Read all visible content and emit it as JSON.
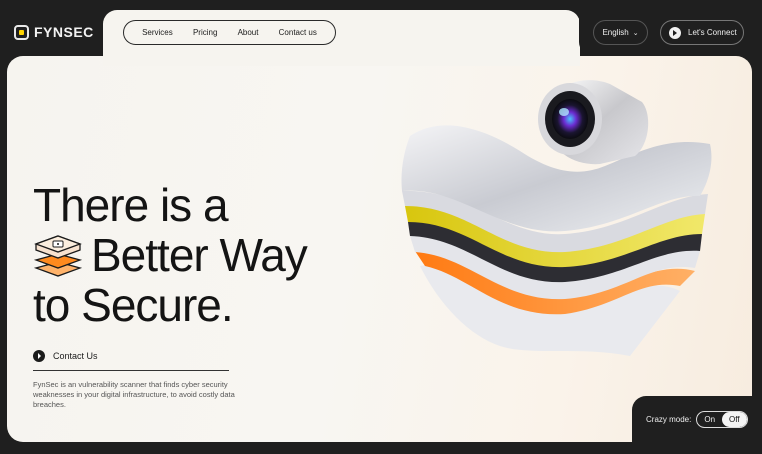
{
  "brand": {
    "name": "FYNSEC",
    "accent": "#ffd400"
  },
  "nav": {
    "items": [
      "Services",
      "Pricing",
      "About",
      "Contact us"
    ]
  },
  "header": {
    "language": "English",
    "connect_label": "Let's Connect"
  },
  "hero": {
    "line1": "There is a",
    "line2": "Better Way",
    "line3": "to Secure.",
    "contact_label": "Contact Us",
    "description": "FynSec is an vulnerability scanner that finds cyber security weaknesses in your digital infrastructure, to avoid costly data breaches."
  },
  "crazy_mode": {
    "label": "Crazy mode:",
    "on": "On",
    "off": "Off",
    "selected": "Off"
  },
  "colors": {
    "background": "#1f1f1f",
    "card": "#f6f4ef",
    "orange": "#ff8a1e",
    "yellow": "#e3d21a"
  }
}
